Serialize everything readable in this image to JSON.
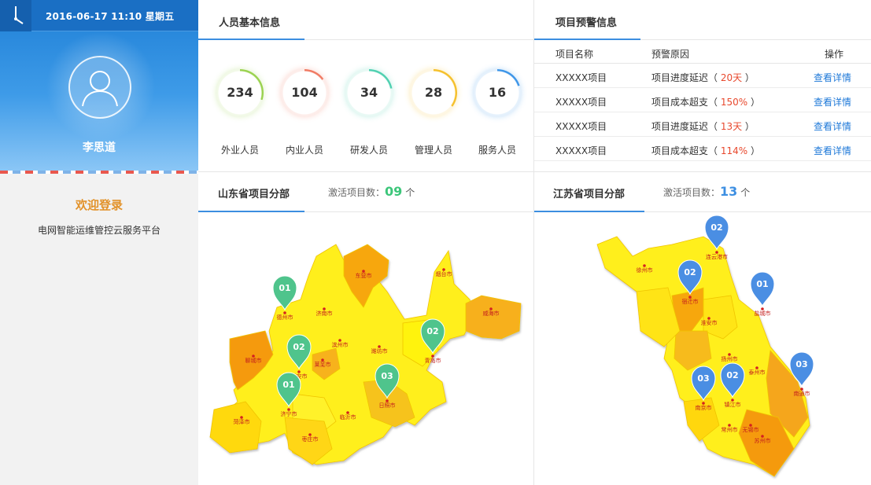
{
  "header": {
    "datetime": "2016-06-17   11:10   星期五"
  },
  "user": {
    "name": "李思道"
  },
  "sidebar": {
    "welcome": "欢迎登录",
    "platform": "电网智能运维管控云服务平台"
  },
  "staff": {
    "title": "人员基本信息",
    "stats": [
      {
        "value": "234",
        "label": "外业人员",
        "color": "#9ad24f",
        "fraction": 0.3
      },
      {
        "value": "104",
        "label": "内业人员",
        "color": "#f07a63",
        "fraction": 0.15
      },
      {
        "value": "34",
        "label": "研发人员",
        "color": "#4fd0b0",
        "fraction": 0.22
      },
      {
        "value": "28",
        "label": "管理人员",
        "color": "#f5c02b",
        "fraction": 0.35
      },
      {
        "value": "16",
        "label": "服务人员",
        "color": "#3d95e8",
        "fraction": 0.2
      }
    ]
  },
  "warn": {
    "title": "项目预警信息",
    "headers": {
      "name": "项目名称",
      "reason": "预警原因",
      "action": "操作"
    },
    "rows": [
      {
        "name": "XXXXX项目",
        "reason": "项目进度延迟",
        "value": "20天",
        "action": "查看详情"
      },
      {
        "name": "XXXXX项目",
        "reason": "项目成本超支",
        "value": "150%",
        "action": "查看详情"
      },
      {
        "name": "XXXXX项目",
        "reason": "项目进度延迟",
        "value": "13天",
        "action": "查看详情"
      },
      {
        "name": "XXXXX项目",
        "reason": "项目成本超支",
        "value": "114%",
        "action": "查看详情"
      }
    ]
  },
  "shandong": {
    "title": "山东省项目分部",
    "active_label": "激活项目数：",
    "active_count": "09",
    "active_unit": "个",
    "count_color": "#3cc67a",
    "pin_color": "#4fc48c",
    "cities": [
      "德州市",
      "济南市",
      "东营市",
      "烟台市",
      "威海市",
      "聊城市",
      "莱芜市",
      "泰安市",
      "潍坊市",
      "青岛市",
      "济宁市",
      "日照市",
      "菏泽市",
      "临沂市",
      "枣庄市",
      "滨州市"
    ],
    "pins": [
      {
        "city": "德州市",
        "count": "01"
      },
      {
        "city": "泰安市",
        "count": "02"
      },
      {
        "city": "济宁市",
        "count": "01"
      },
      {
        "city": "青岛市",
        "count": "02"
      },
      {
        "city": "日照市",
        "count": "03"
      }
    ]
  },
  "jiangsu": {
    "title": "江苏省项目分部",
    "active_label": "激活项目数：",
    "active_count": "13",
    "active_unit": "个",
    "count_color": "#3d8fe2",
    "pin_color": "#4a8ee3",
    "cities": [
      "连云港市",
      "徐州市",
      "宿迁市",
      "盐城市",
      "淮安市",
      "扬州市",
      "泰州市",
      "南京市",
      "镇江市",
      "常州市",
      "无锡市",
      "苏州市",
      "南通市"
    ],
    "pins": [
      {
        "city": "连云港市",
        "count": "02"
      },
      {
        "city": "宿迁市",
        "count": "02"
      },
      {
        "city": "盐城市",
        "count": "01"
      },
      {
        "city": "南京市",
        "count": "03"
      },
      {
        "city": "镇江市",
        "count": "02"
      },
      {
        "city": "南通市",
        "count": "03"
      }
    ]
  }
}
